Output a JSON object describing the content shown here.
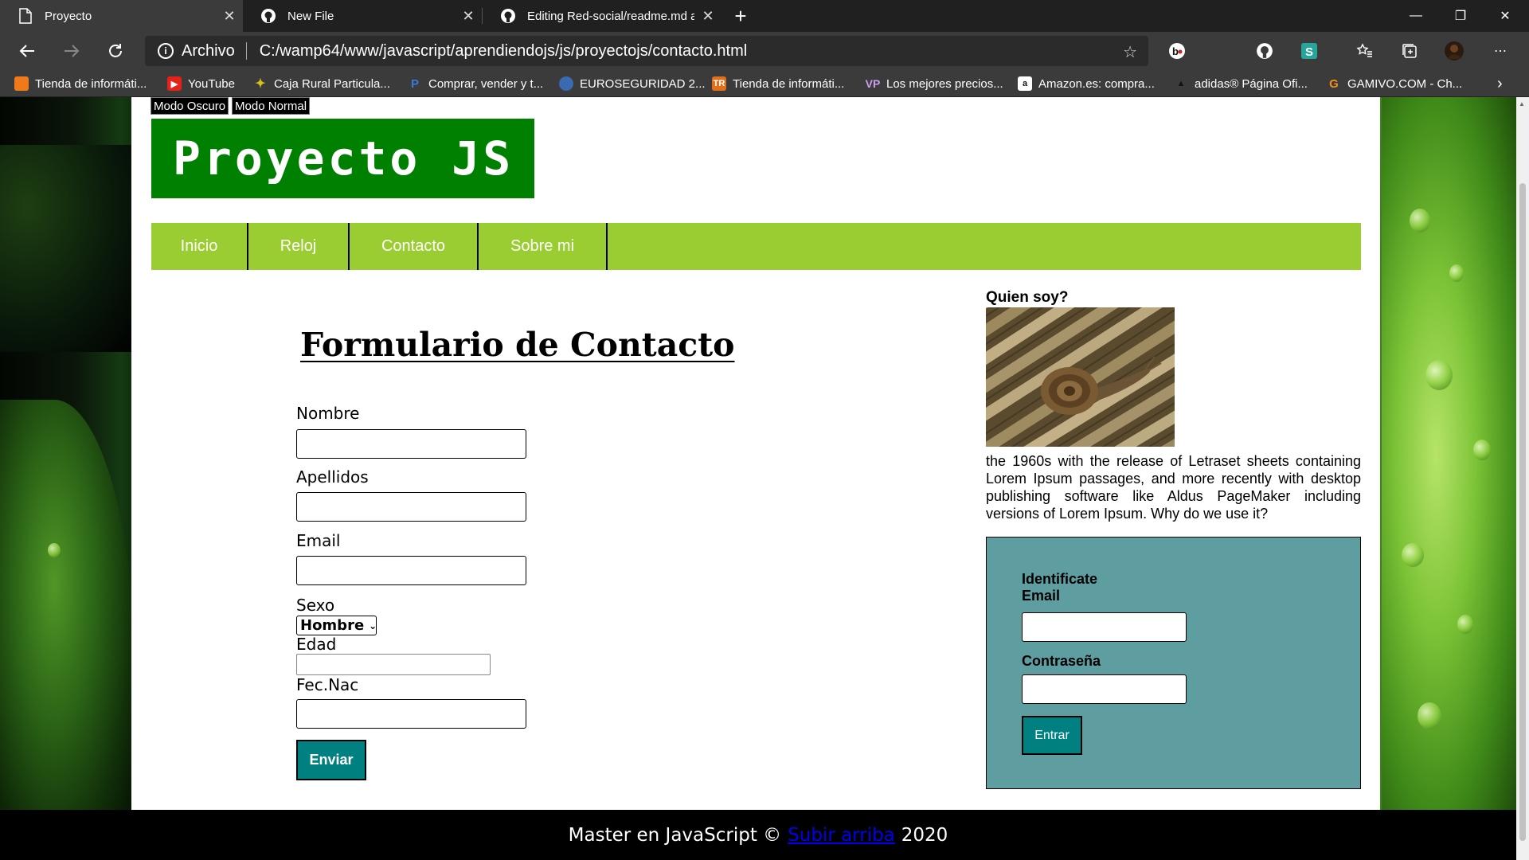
{
  "browser": {
    "tabs": [
      {
        "title": "Proyecto",
        "active": true
      },
      {
        "title": "New File",
        "active": false
      },
      {
        "title": "Editing Red-social/readme.md at",
        "active": false
      }
    ],
    "address": {
      "scheme_label": "Archivo",
      "url": "C:/wamp64/www/javascript/aprendiendojs/js/proyectojs/contacto.html"
    },
    "bookmarks": [
      {
        "label": "Tienda de informáti...",
        "icon": "shop-icon",
        "color": "#f07a1a"
      },
      {
        "label": "YouTube",
        "icon": "youtube-icon",
        "color": "#e62117"
      },
      {
        "label": "Caja Rural Particula...",
        "icon": "caja-rural-icon",
        "color": "#d4c21a"
      },
      {
        "label": "Comprar, vender y t...",
        "icon": "paypal-icon",
        "color": "#1f4fa0"
      },
      {
        "label": "EUROSEGURIDAD 2...",
        "icon": "euroseguridad-icon",
        "color": "#3a6ab0"
      },
      {
        "label": "Tienda de informáti...",
        "icon": "tr-icon",
        "color": "#e0701a"
      },
      {
        "label": "Los mejores precios...",
        "icon": "vp-icon",
        "color": "#7a3aa0"
      },
      {
        "label": "Amazon.es: compra...",
        "icon": "amazon-icon",
        "color": "#ffffff"
      },
      {
        "label": "adidas® Página Ofi...",
        "icon": "adidas-icon",
        "color": "#3b3b3b"
      },
      {
        "label": "GAMIVO.COM - Ch...",
        "icon": "gamivo-icon",
        "color": "#f0901a"
      }
    ]
  },
  "page": {
    "mode_buttons": [
      "Modo Oscuro",
      "Modo Normal"
    ],
    "logo": "Proyecto JS",
    "menu": [
      "Inicio",
      "Reloj",
      "Contacto",
      "Sobre mi"
    ],
    "form": {
      "title": "Formulario de Contacto",
      "labels": {
        "nombre": "Nombre",
        "apellidos": "Apellidos",
        "email": "Email",
        "sexo": "Sexo",
        "edad": "Edad",
        "fecnac": "Fec.Nac"
      },
      "sexo_selected": "Hombre",
      "submit": "Enviar"
    },
    "aside": {
      "title": "Quien soy?",
      "text": "the 1960s with the release of Letraset sheets containing Lorem Ipsum passages, and more recently with desktop publishing software like Aldus PageMaker including versions of Lorem Ipsum. Why do we use it?",
      "login": {
        "heading": "Identificate",
        "email_label": "Email",
        "password_label": "Contraseña",
        "button": "Entrar"
      }
    },
    "footer": {
      "prefix": "Master en JavaScript ©",
      "link": "Subir arriba",
      "year": "2020"
    }
  },
  "colors": {
    "logo_bg": "#008000",
    "menu_bg": "#9acd32",
    "button_bg": "#008080",
    "login_bg": "#5f9ea0"
  }
}
